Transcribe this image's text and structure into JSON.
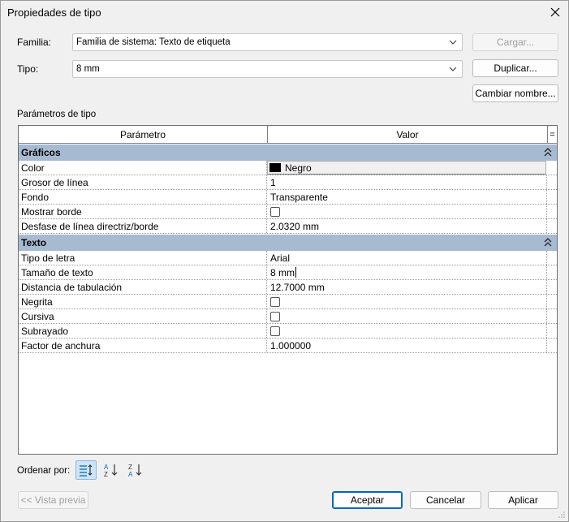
{
  "window": {
    "title": "Propiedades de tipo"
  },
  "family": {
    "label": "Familia:",
    "value": "Familia de sistema: Texto de etiqueta"
  },
  "type": {
    "label": "Tipo:",
    "value": "8 mm"
  },
  "buttons": {
    "load": "Cargar...",
    "duplicate": "Duplicar...",
    "rename": "Cambiar nombre...",
    "preview": "<< Vista previa",
    "ok": "Aceptar",
    "cancel": "Cancelar",
    "apply": "Aplicar"
  },
  "params_section_label": "Parámetros de tipo",
  "grid": {
    "col_param": "Parámetro",
    "col_value": "Valor",
    "col_extra": "=",
    "groups": [
      {
        "name": "Gráficos",
        "rows": [
          {
            "param": "Color",
            "value": "Negro",
            "kind": "color",
            "swatch": "#000000"
          },
          {
            "param": "Grosor de línea",
            "value": "1"
          },
          {
            "param": "Fondo",
            "value": "Transparente"
          },
          {
            "param": "Mostrar borde",
            "kind": "checkbox",
            "checked": false
          },
          {
            "param": "Desfase de línea directriz/borde",
            "value": "2.0320 mm"
          }
        ]
      },
      {
        "name": "Texto",
        "rows": [
          {
            "param": "Tipo de letra",
            "value": "Arial"
          },
          {
            "param": "Tamaño de texto",
            "value": "8 mm",
            "editing": true
          },
          {
            "param": "Distancia de tabulación",
            "value": "12.7000 mm"
          },
          {
            "param": "Negrita",
            "kind": "checkbox",
            "checked": false
          },
          {
            "param": "Cursiva",
            "kind": "checkbox",
            "checked": false
          },
          {
            "param": "Subrayado",
            "kind": "checkbox",
            "checked": false
          },
          {
            "param": "Factor de anchura",
            "value": "1.000000"
          }
        ]
      }
    ]
  },
  "sort": {
    "label": "Ordenar por:",
    "icons": [
      "grouped-sort-icon",
      "sort-ascending-icon",
      "sort-descending-icon"
    ]
  },
  "colors": {
    "group_header": "#a6bbd2",
    "accent": "#0067c0"
  }
}
